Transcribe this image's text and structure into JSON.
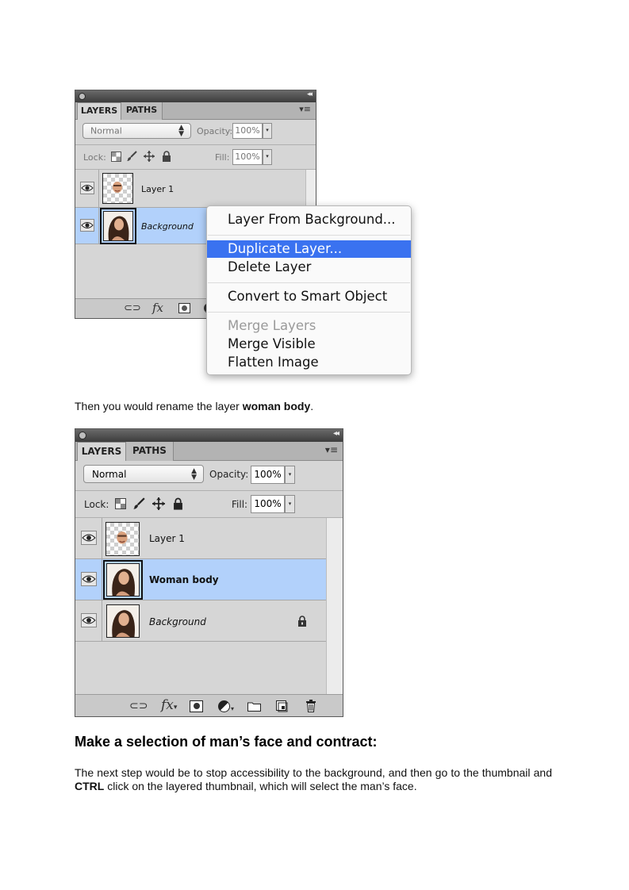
{
  "panel1": {
    "tabs": [
      "LAYERS",
      "PATHS"
    ],
    "blend_mode": "Normal",
    "opacity_label": "Opacity:",
    "opacity_value": "100%",
    "lock_label": "Lock:",
    "fill_label": "Fill:",
    "fill_value": "100%",
    "layers": [
      {
        "name": "Layer 1"
      },
      {
        "name": "Background"
      }
    ]
  },
  "context_menu": {
    "items": [
      {
        "label": "Layer From Background..."
      },
      {
        "label": "Duplicate Layer..."
      },
      {
        "label": "Delete Layer"
      },
      {
        "label": "Convert to Smart Object"
      },
      {
        "label": "Merge Layers"
      },
      {
        "label": "Merge Visible"
      },
      {
        "label": "Flatten Image"
      }
    ],
    "highlighted": "Duplicate Layer...",
    "disabled": "Merge Layers"
  },
  "text1": {
    "before": "Then you would rename the layer ",
    "bold": "woman body",
    "after": "."
  },
  "panel2": {
    "tabs": [
      "LAYERS",
      "PATHS"
    ],
    "blend_mode": "Normal",
    "opacity_label": "Opacity:",
    "opacity_value": "100%",
    "lock_label": "Lock:",
    "fill_label": "Fill:",
    "fill_value": "100%",
    "layers": [
      {
        "name": "Layer 1"
      },
      {
        "name": "Woman body"
      },
      {
        "name": "Background"
      }
    ]
  },
  "heading": "Make a selection of man’s face and contract:",
  "paragraph": {
    "part1": "The next step would be to stop accessibility to the background, and then go to the thumbnail and ",
    "bold": "CTRL",
    "part2": " click on the layered thumbnail, which will select the man’s face."
  },
  "icons": {
    "link": "link-icon",
    "fx": "fx-icon",
    "mask": "mask-icon",
    "adjustment": "adjustment-icon",
    "folder": "folder-icon",
    "new_layer": "new-layer-icon",
    "trash": "trash-icon",
    "eye": "eye-icon",
    "lock": "lock-icon"
  },
  "colors": {
    "selected_layer": "#b2d1fb",
    "menu_highlight": "#3a72f0",
    "panel_bg": "#d6d6d6"
  }
}
